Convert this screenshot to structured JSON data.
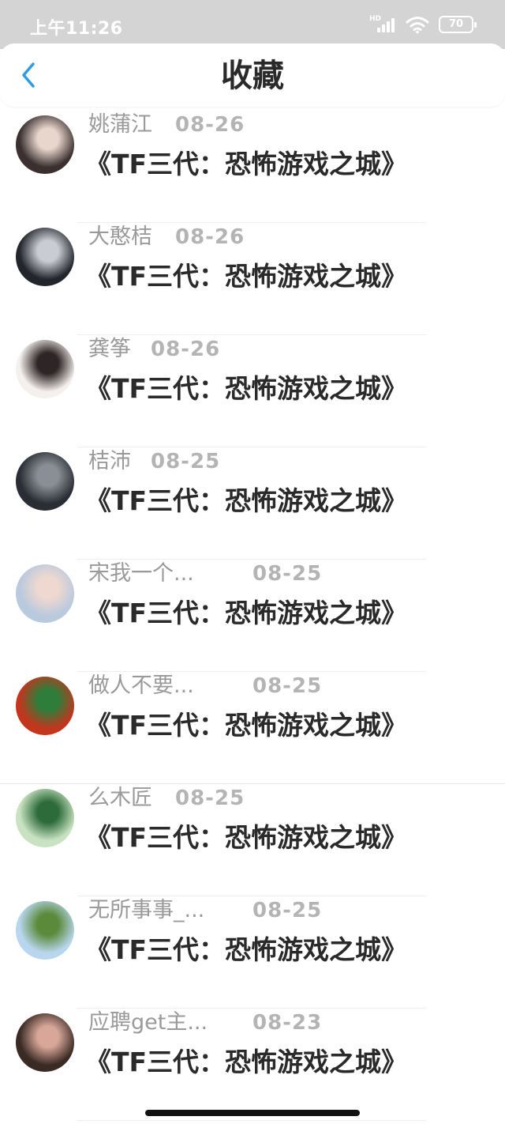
{
  "status_bar": {
    "time": "上午11:26",
    "battery": "70",
    "network": "HD"
  },
  "header": {
    "title": "收藏"
  },
  "items": [
    {
      "username": "姚蒲江",
      "date": "08-26",
      "title": "《TF三代：恐怖游戏之城》",
      "avatar_colors": [
        "#3a3030",
        "#e8d6cc"
      ]
    },
    {
      "username": "大憨桔",
      "date": "08-26",
      "title": "《TF三代：恐怖游戏之城》",
      "avatar_colors": [
        "#22262c",
        "#c9ccd2"
      ]
    },
    {
      "username": "龚筝",
      "date": "08-26",
      "title": "《TF三代：恐怖游戏之城》",
      "avatar_colors": [
        "#f4f0ee",
        "#2e2626"
      ]
    },
    {
      "username": "桔沛",
      "date": "08-25",
      "title": "《TF三代：恐怖游戏之城》",
      "avatar_colors": [
        "#2a2e34",
        "#8a8e96"
      ]
    },
    {
      "username": "宋我一个...",
      "date": "08-25",
      "title": "《TF三代：恐怖游戏之城》",
      "avatar_colors": [
        "#b9c9de",
        "#efd8cf"
      ]
    },
    {
      "username": "做人不要...",
      "date": "08-25",
      "title": "《TF三代：恐怖游戏之城》",
      "avatar_colors": [
        "#c2361e",
        "#2f7d3a"
      ]
    },
    {
      "username": "么木匠",
      "date": "08-25",
      "title": "《TF三代：恐怖游戏之城》",
      "avatar_colors": [
        "#c9e3c2",
        "#2e6b3a"
      ]
    },
    {
      "username": "无所事事_...",
      "date": "08-25",
      "title": "《TF三代：恐怖游戏之城》",
      "avatar_colors": [
        "#b8d6ee",
        "#5a8a3a"
      ]
    },
    {
      "username": "应聘get主...",
      "date": "08-23",
      "title": "《TF三代：恐怖游戏之城》",
      "avatar_colors": [
        "#3a2a24",
        "#d9a79a"
      ]
    }
  ]
}
